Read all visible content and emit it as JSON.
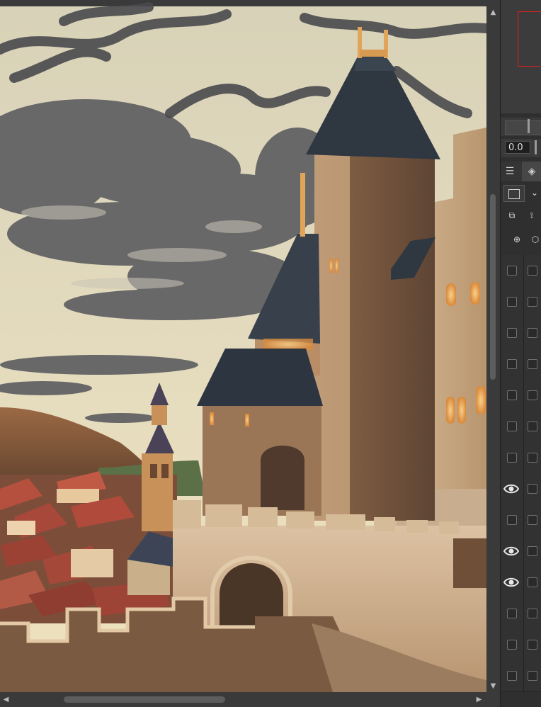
{
  "canvas": {
    "artwork": "castle-painting",
    "colors": {
      "sky": "#e6dfc2",
      "cloud": "#5b5b5e",
      "roof": "#2e3740",
      "stone": "#c9ab87",
      "tile_roof": "#a8483a",
      "window_glow": "#e8a458"
    }
  },
  "scrollbars": {
    "up_arrow": "▲",
    "down_arrow": "▼",
    "left_arrow": "◀",
    "right_arrow": "▶"
  },
  "panel": {
    "opacity_value": "0.0",
    "tabs": [
      {
        "label": "☰",
        "icon": "menu-icon"
      },
      {
        "label": "◈",
        "icon": "layers-icon"
      }
    ],
    "layer_rows": [
      {
        "visible": false
      },
      {
        "visible": false
      },
      {
        "visible": false
      },
      {
        "visible": false
      },
      {
        "visible": false
      },
      {
        "visible": false
      },
      {
        "visible": false
      },
      {
        "visible": true
      },
      {
        "visible": false
      },
      {
        "visible": true
      },
      {
        "visible": true
      },
      {
        "visible": false
      },
      {
        "visible": false
      },
      {
        "visible": false
      }
    ]
  }
}
